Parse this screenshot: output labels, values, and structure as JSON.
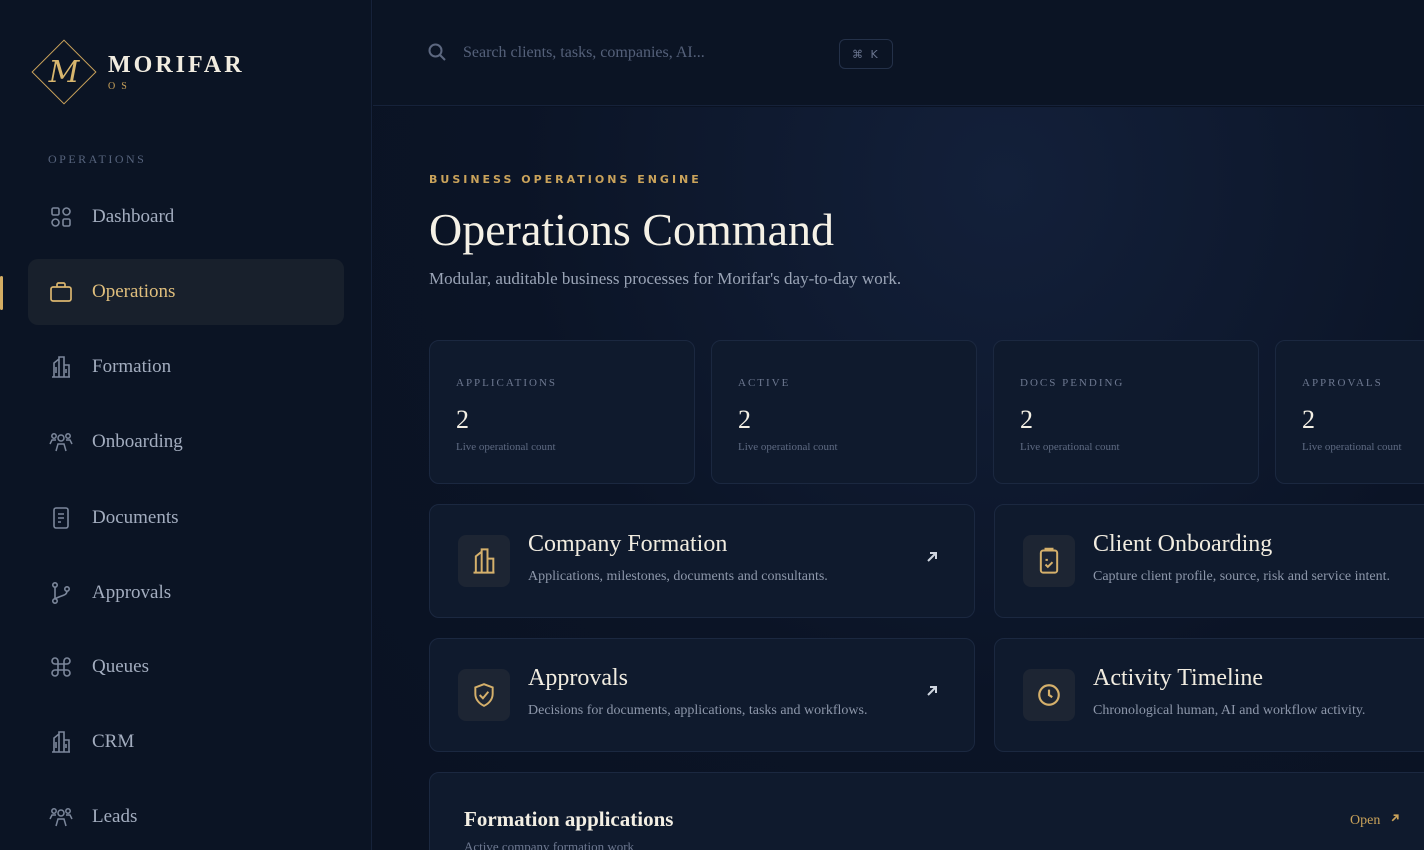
{
  "brand": {
    "name": "MORIFAR",
    "sub": "OS",
    "monogram": "M"
  },
  "sidebar": {
    "section_label": "OPERATIONS",
    "items": [
      {
        "label": "Dashboard",
        "icon": "grid-icon",
        "active": false
      },
      {
        "label": "Operations",
        "icon": "briefcase-icon",
        "active": true
      },
      {
        "label": "Formation",
        "icon": "building-icon",
        "active": false
      },
      {
        "label": "Onboarding",
        "icon": "users-icon",
        "active": false
      },
      {
        "label": "Documents",
        "icon": "document-icon",
        "active": false
      },
      {
        "label": "Approvals",
        "icon": "branch-icon",
        "active": false
      },
      {
        "label": "Queues",
        "icon": "command-icon",
        "active": false
      },
      {
        "label": "CRM",
        "icon": "building-icon",
        "active": false
      },
      {
        "label": "Leads",
        "icon": "users-icon",
        "active": false
      }
    ]
  },
  "search": {
    "placeholder": "Search clients, tasks, companies, AI...",
    "shortcut": "⌘ K"
  },
  "header": {
    "eyebrow": "BUSINESS OPERATIONS ENGINE",
    "title": "Operations Command",
    "subtitle": "Modular, auditable business processes for Morifar's day-to-day work."
  },
  "stats": [
    {
      "label": "APPLICATIONS",
      "value": "2",
      "note": "Live operational count"
    },
    {
      "label": "ACTIVE",
      "value": "2",
      "note": "Live operational count"
    },
    {
      "label": "DOCS PENDING",
      "value": "2",
      "note": "Live operational count"
    },
    {
      "label": "APPROVALS",
      "value": "2",
      "note": "Live operational count"
    }
  ],
  "modules": [
    {
      "title": "Company Formation",
      "desc": "Applications, milestones, documents and consultants.",
      "icon": "building-icon"
    },
    {
      "title": "Client Onboarding",
      "desc": "Capture client profile, source, risk and service intent.",
      "icon": "clipboard-icon"
    },
    {
      "title": "Approvals",
      "desc": "Decisions for documents, applications, tasks and workflows.",
      "icon": "shield-icon"
    },
    {
      "title": "Activity Timeline",
      "desc": "Chronological human, AI and workflow activity.",
      "icon": "clock-icon"
    }
  ],
  "panel": {
    "title": "Formation applications",
    "subtitle": "Active company formation work",
    "open_label": "Open"
  },
  "colors": {
    "accent": "#c9a25a",
    "background": "#0a1222",
    "card": "#0f1a2d"
  }
}
